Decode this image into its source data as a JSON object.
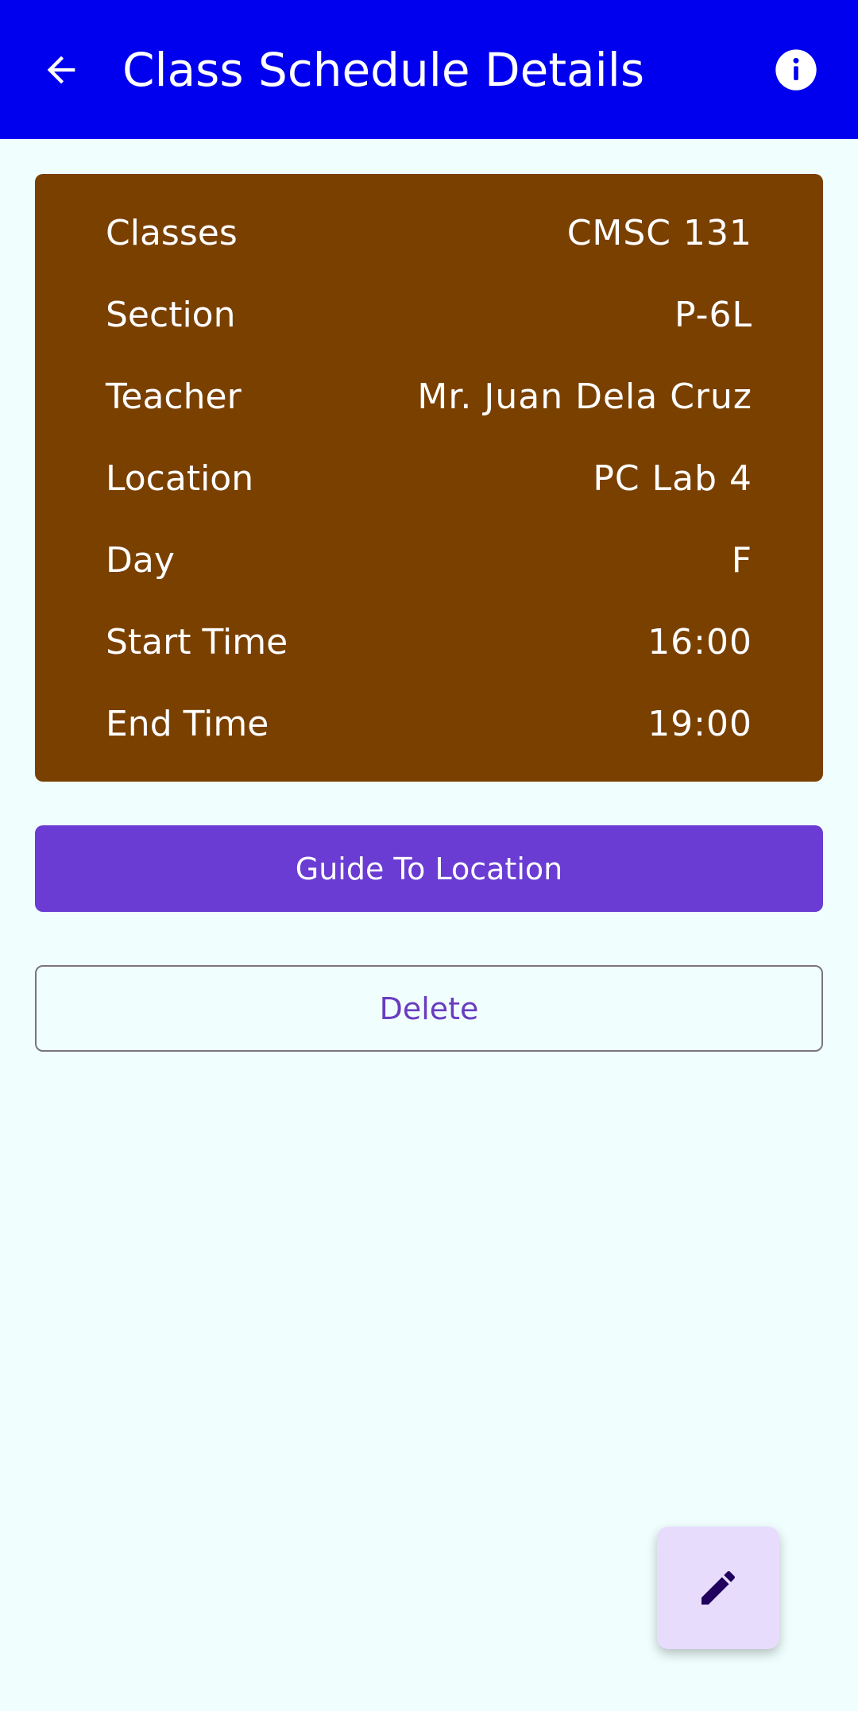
{
  "header": {
    "title": "Class Schedule Details",
    "back_icon": "arrow-left-icon",
    "info_icon": "info-icon",
    "background": "#0000ef"
  },
  "details": {
    "background": "#7a4000",
    "rows": [
      {
        "label": "Classes",
        "value": "CMSC 131"
      },
      {
        "label": "Section",
        "value": "P-6L"
      },
      {
        "label": "Teacher",
        "value": "Mr. Juan Dela Cruz"
      },
      {
        "label": "Location",
        "value": "PC Lab 4"
      },
      {
        "label": "Day",
        "value": "F"
      },
      {
        "label": "Start Time",
        "value": "16:00"
      },
      {
        "label": "End Time",
        "value": "19:00"
      }
    ]
  },
  "actions": {
    "guide_label": "Guide To Location",
    "delete_label": "Delete",
    "accent": "#6a3cd3"
  },
  "fab": {
    "icon": "pencil-icon",
    "background": "#e8dcfc"
  }
}
